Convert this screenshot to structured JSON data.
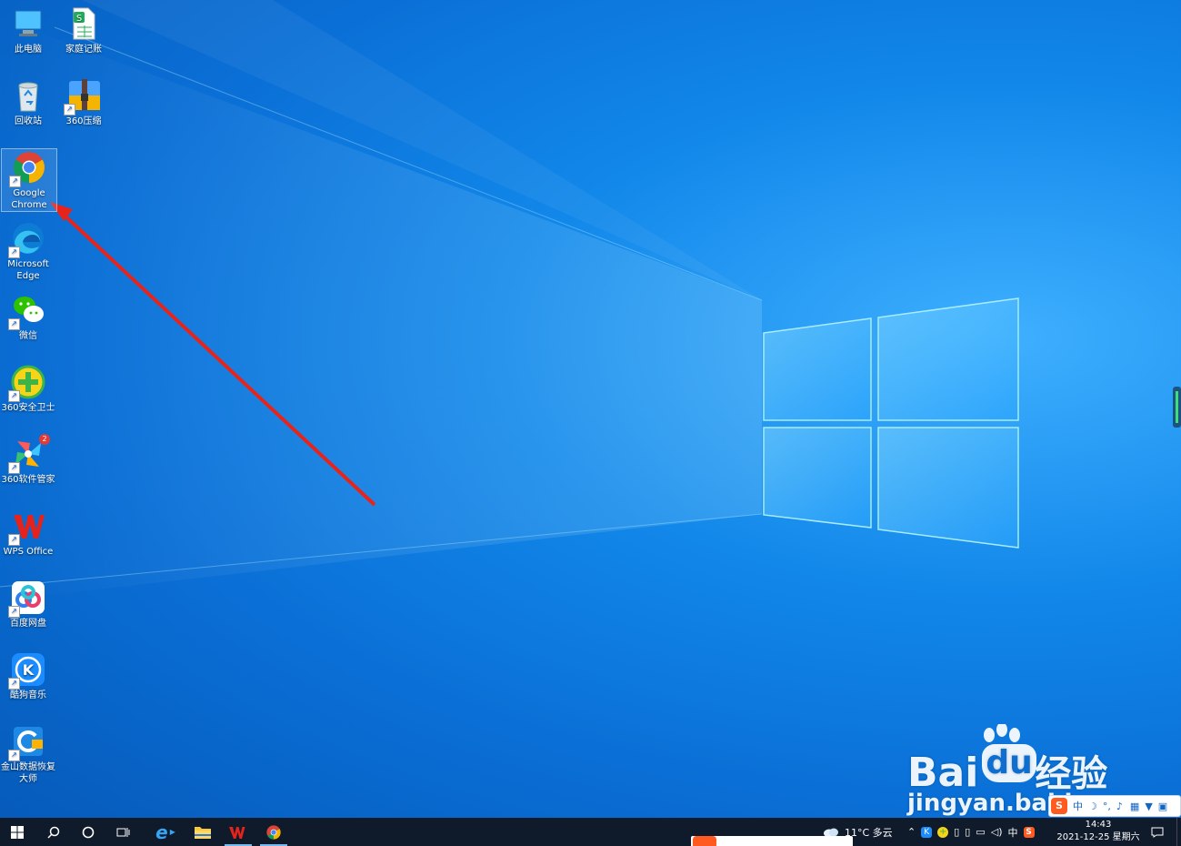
{
  "desktop": {
    "icons": [
      {
        "label": "此电脑"
      },
      {
        "label": "家庭记账"
      },
      {
        "label": "回收站"
      },
      {
        "label": "360压缩"
      },
      {
        "label": "Google Chrome"
      },
      {
        "label": "Microsoft Edge"
      },
      {
        "label": "微信"
      },
      {
        "label": "360安全卫士"
      },
      {
        "label": "360软件管家",
        "badge": "2"
      },
      {
        "label": "WPS Office"
      },
      {
        "label": "百度网盘"
      },
      {
        "label": "酷狗音乐"
      },
      {
        "label": "金山数据恢复大师"
      }
    ]
  },
  "watermark": {
    "brand_latin": "Bai",
    "brand_du": "du",
    "brand_cn": "经验",
    "url": "jingyan.baidu.com"
  },
  "ime_toolbar": {
    "lang": "中"
  },
  "taskbar": {
    "weather": "11°C 多云",
    "ime_indicator": "中",
    "time": "14:43",
    "date": "2021-12-25 星期六"
  },
  "colors": {
    "annotation_arrow": "#e8231a",
    "taskbar_bg": "#0f1a2a",
    "accent": "#76b9ed"
  }
}
